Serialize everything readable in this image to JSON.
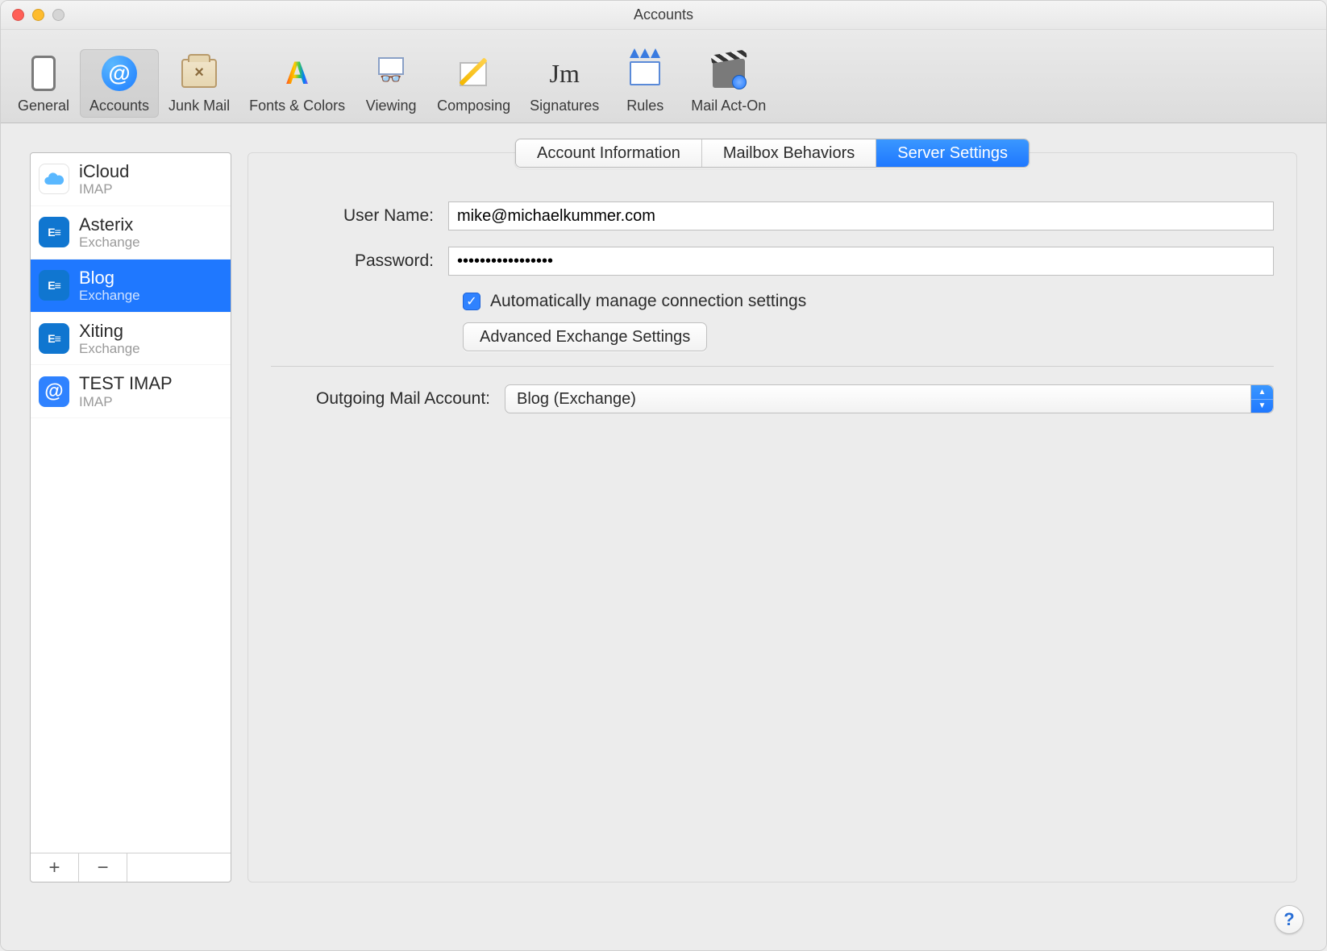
{
  "window": {
    "title": "Accounts"
  },
  "toolbar": {
    "items": [
      {
        "id": "general",
        "label": "General"
      },
      {
        "id": "accounts",
        "label": "Accounts",
        "selected": true
      },
      {
        "id": "junk",
        "label": "Junk Mail"
      },
      {
        "id": "fonts",
        "label": "Fonts & Colors"
      },
      {
        "id": "viewing",
        "label": "Viewing"
      },
      {
        "id": "composing",
        "label": "Composing"
      },
      {
        "id": "signatures",
        "label": "Signatures"
      },
      {
        "id": "rules",
        "label": "Rules"
      },
      {
        "id": "mailacton",
        "label": "Mail Act-On"
      }
    ]
  },
  "sidebar": {
    "accounts": [
      {
        "name": "iCloud",
        "type": "IMAP",
        "icon": "cloud"
      },
      {
        "name": "Asterix",
        "type": "Exchange",
        "icon": "exchange"
      },
      {
        "name": "Blog",
        "type": "Exchange",
        "icon": "exchange",
        "selected": true
      },
      {
        "name": "Xiting",
        "type": "Exchange",
        "icon": "exchange"
      },
      {
        "name": "TEST IMAP",
        "type": "IMAP",
        "icon": "at"
      }
    ],
    "add_label": "+",
    "remove_label": "−"
  },
  "tabs": {
    "items": [
      {
        "label": "Account Information"
      },
      {
        "label": "Mailbox Behaviors"
      },
      {
        "label": "Server Settings",
        "active": true
      }
    ]
  },
  "form": {
    "username_label": "User Name:",
    "username_value": "mike@michaelkummer.com",
    "password_label": "Password:",
    "password_value": "•••••••••••••••••",
    "auto_manage_label": "Automatically manage connection settings",
    "auto_manage_checked": true,
    "advanced_button": "Advanced Exchange Settings",
    "outgoing_label": "Outgoing Mail Account:",
    "outgoing_value": "Blog (Exchange)"
  },
  "help_label": "?"
}
